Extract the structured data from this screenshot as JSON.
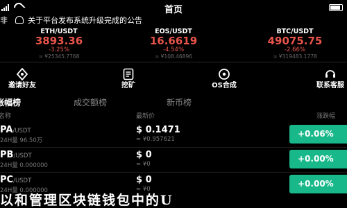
{
  "status": {
    "time": "首页"
  },
  "notice": {
    "tail": "非",
    "message": "关于平台发布系统升级完成的公告"
  },
  "tickers": [
    {
      "pair": "ETH/USDT",
      "price": "3893.36",
      "change": "-3.25%",
      "cny": "≈ ¥25345.7768"
    },
    {
      "pair": "EOS/USDT",
      "price": "16.6619",
      "change": "-4.54%",
      "cny": "≈ ¥108.46896"
    },
    {
      "pair": "BTC/USDT",
      "price": "49075.75",
      "change": "-2.66%",
      "cny": "≈ ¥319483.1778"
    }
  ],
  "quick_actions": [
    {
      "label": "邀请好友",
      "icon": "invite-icon"
    },
    {
      "label": "挖矿",
      "icon": "mining-icon"
    },
    {
      "label": "OS合成",
      "icon": "os-synthesis-icon"
    },
    {
      "label": "联系客服",
      "icon": "customer-service-icon"
    }
  ],
  "tabs": {
    "active": "涨幅榜",
    "second": "成交额榜",
    "third": "新币榜"
  },
  "columns": {
    "name": "名称",
    "price": "最新价",
    "change": "涨跌幅"
  },
  "rows": [
    {
      "base": "PA",
      "quote": "/USDT",
      "volume": "24H量 96.50万",
      "price": "$ 0.1471",
      "price_cny": "≈ ¥0.957621",
      "change": "+0.06%"
    },
    {
      "base": "PB",
      "quote": "/USDT",
      "volume": "24H量 0.000000",
      "price": "$ 0",
      "price_cny": "≈ ¥0",
      "change": "+0.00%"
    },
    {
      "base": "PC",
      "quote": "/USDT",
      "volume": "24H量 0.000000",
      "price": "$ 0",
      "price_cny": "≈ ¥0",
      "change": "+0.00%"
    }
  ],
  "overlay_text": "以和管理区块链钱包中的U",
  "colors": {
    "down": "#e8544a",
    "up": "#19b88a",
    "background": "#000000"
  }
}
